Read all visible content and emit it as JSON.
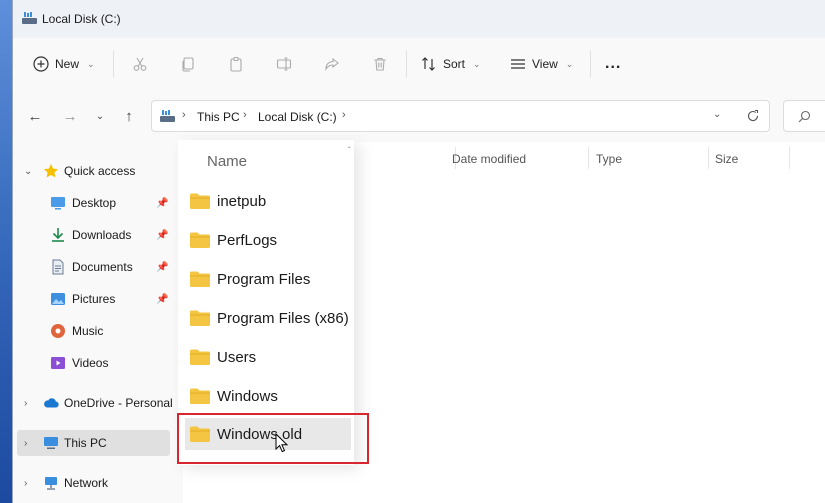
{
  "window": {
    "title": "Local Disk (C:)"
  },
  "toolbar": {
    "new_label": "New",
    "sort_label": "Sort",
    "view_label": "View",
    "more_label": "..."
  },
  "address": {
    "crumbs": [
      "This PC",
      "Local Disk (C:)"
    ]
  },
  "nav_pane": {
    "quick_access": "Quick access",
    "pinned": [
      {
        "label": "Desktop",
        "icon": "desktop-icon",
        "pinned": true
      },
      {
        "label": "Downloads",
        "icon": "downloads-icon",
        "pinned": true
      },
      {
        "label": "Documents",
        "icon": "documents-icon",
        "pinned": true
      },
      {
        "label": "Pictures",
        "icon": "pictures-icon",
        "pinned": true
      },
      {
        "label": "Music",
        "icon": "music-icon",
        "pinned": false
      },
      {
        "label": "Videos",
        "icon": "videos-icon",
        "pinned": false
      }
    ],
    "onedrive": "OneDrive - Personal",
    "this_pc": "This PC",
    "network": "Network"
  },
  "content": {
    "columns": {
      "name": "Name",
      "date_modified": "Date modified",
      "type": "Type",
      "size": "Size"
    },
    "items": [
      "inetpub",
      "PerfLogs",
      "Program Files",
      "Program Files (x86)",
      "Users",
      "Windows",
      "Windows.old"
    ],
    "hovered_item": "Windows.old"
  },
  "colors": {
    "folder": "#f4c542",
    "highlight": "#d9262e",
    "accent": "#0067c0"
  }
}
